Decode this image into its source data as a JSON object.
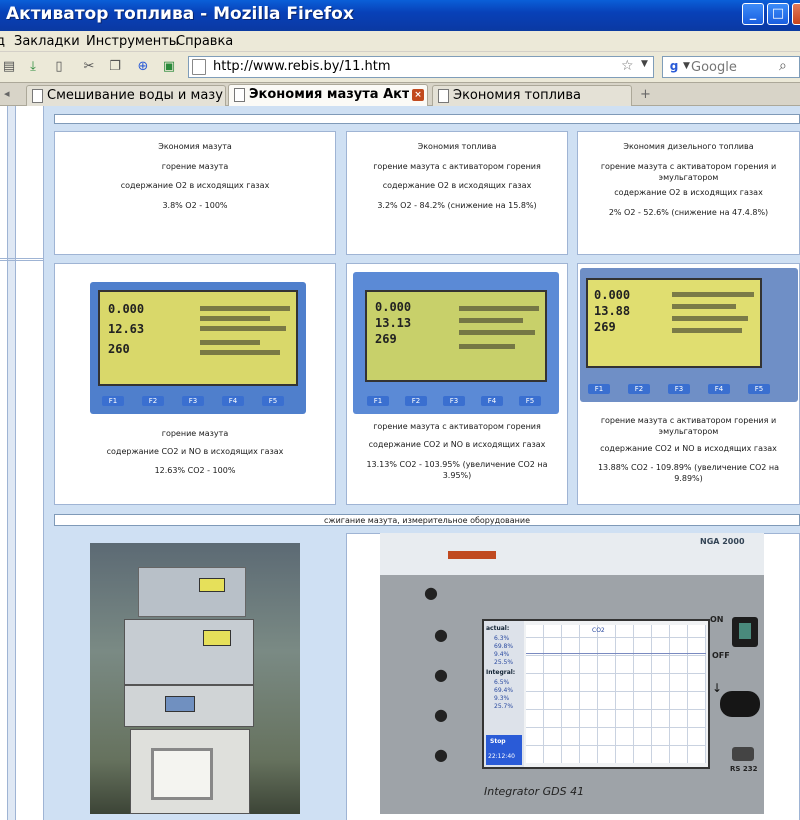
{
  "window": {
    "title": "Активатор топлива - Mozilla Firefox"
  },
  "menu": [
    "Закладки",
    "Инструменты",
    "Справка"
  ],
  "nav": {
    "url": "http://www.rebis.by/11.htm",
    "search_placeholder": "Google",
    "search_engine_letter": "g"
  },
  "tabs": [
    {
      "label": "Смешивание воды и мазу...",
      "active": false
    },
    {
      "label": "Экономия мазута Акт...",
      "active": true
    },
    {
      "label": "Экономия топлива",
      "active": false
    }
  ],
  "tab_new": "+",
  "row1": [
    {
      "lines": [
        "Экономия мазута",
        "горение мазута",
        "содержание О2 в исходящих газах",
        "3.8% О2 - 100%"
      ]
    },
    {
      "lines": [
        "Экономия топлива",
        "горение мазута с активатором горения",
        "содержание О2 в исходящих газах",
        "3.2% О2 - 84.2% (снижение на 15.8%)"
      ]
    },
    {
      "lines": [
        "Экономия дизельного топлива",
        "горение мазута с активатором горения и",
        "эмульгатором",
        "содержание О2 в исходящих газах",
        "2% О2 - 52.6% (снижение на 47.4.8%)"
      ]
    }
  ],
  "row2": [
    {
      "readings": [
        "0.000",
        "12.63",
        "260"
      ],
      "keys": [
        "F1",
        "F2",
        "F3",
        "F4",
        "F5"
      ],
      "lines": [
        "горение мазута",
        "содержание СО2 и NO в исходящих газах",
        "12.63% СО2 - 100%"
      ]
    },
    {
      "readings": [
        "0.000",
        "13.13",
        "269"
      ],
      "keys": [
        "F1",
        "F2",
        "F3",
        "F4",
        "F5"
      ],
      "lines": [
        "горение мазута с активатором горения",
        "содержание СО2 и NO в исходящих газах",
        "13.13% СО2 - 103.95% (увеличение СО2 на",
        "3.95%)"
      ]
    },
    {
      "readings": [
        "0.000",
        "13.88",
        "269"
      ],
      "keys": [
        "F1",
        "F2",
        "F3",
        "F4",
        "F5"
      ],
      "lines": [
        "горение мазута с активатором горения и",
        "эмульгатором",
        "содержание СО2 и NO в исходящих газах",
        "13.88% СО2 - 109.89% (увеличение СО2 на",
        "9.89%)"
      ]
    }
  ],
  "strip_caption": "сжигание мазута, измерительное оборудование",
  "gds": {
    "brand": "NGA 2000",
    "label": "Integrator GDS 41",
    "on": "ON",
    "off": "OFF",
    "port": "RS 232",
    "actual_label": "actual:",
    "actual_values": [
      "6.3%",
      "69.8%",
      "9.4%",
      "25.5%"
    ],
    "integral_label": "Integral:",
    "integral_values": [
      "6.5%",
      "69.4%",
      "9.3%",
      "25.7%"
    ],
    "stop": "Stop",
    "time": "22:12:40",
    "chart_tag": "CO2"
  }
}
